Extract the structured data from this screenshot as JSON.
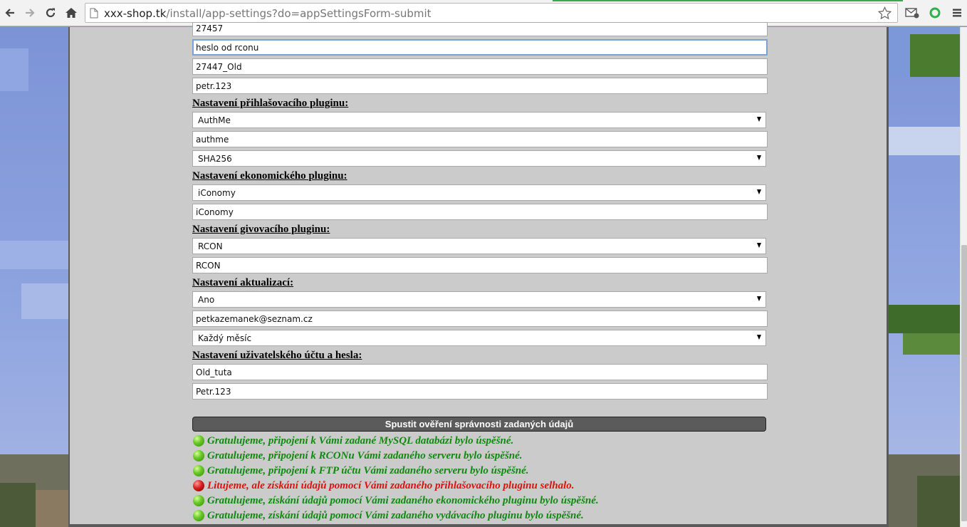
{
  "browser": {
    "url_host": "xxx-shop.tk",
    "url_path": "/install/app-settings?do=appSettingsForm-submit"
  },
  "form": {
    "rcon_port": "27457",
    "rcon_password": "heslo od rconu",
    "ftp_user": "27447_Old",
    "ftp_password": "petr.123",
    "login_heading": "Nastavení přihlašovacího pluginu:",
    "login_plugin": "AuthMe",
    "login_table": "authme",
    "login_hash": "SHA256",
    "economy_heading": "Nastavení ekonomického pluginu:",
    "economy_plugin": "iConomy",
    "economy_table": "iConomy",
    "give_heading": "Nastavení givovacího pluginu:",
    "give_plugin": "RCON",
    "give_value": "RCON",
    "update_heading": "Nastavení aktualizací:",
    "update_enabled": "Ano",
    "update_email": "petkazemanek@seznam.cz",
    "update_interval": "Každý měsíc",
    "account_heading": "Nastavení uživatelského účtu a hesla:",
    "account_user": "Old_tuta",
    "account_password": "Petr.123",
    "verify_button": "Spustit ověření správnosti zadaných údajů"
  },
  "messages": [
    {
      "status": "ok",
      "text": "Gratulujeme, připojení k Vámi zadané MySQL databázi bylo úspěšné."
    },
    {
      "status": "ok",
      "text": "Gratulujeme, připojení k RCONu Vámi zadaného serveru bylo úspěšné."
    },
    {
      "status": "ok",
      "text": "Gratulujeme, připojení k FTP účtu Vámi zadaného serveru bylo úspěšné."
    },
    {
      "status": "error",
      "text": "Litujeme, ale získání údajů pomocí Vámi zadaného přihlašovacího pluginu selhalo."
    },
    {
      "status": "ok",
      "text": "Gratulujeme, získání údajů pomocí Vámi zadaného ekonomického pluginu bylo úspěšné."
    },
    {
      "status": "ok",
      "text": "Gratulujeme, získání údajů pomocí Vámi zadaného vydávacího pluginu bylo úspěšné."
    }
  ],
  "colors": {
    "success": "#0f8a0f",
    "error": "#e01010",
    "panel": "#cbcbcb",
    "button": "#5b5b5b"
  },
  "icons": [
    "back-arrow-icon",
    "forward-arrow-icon",
    "reload-icon",
    "home-icon",
    "page-icon",
    "bookmark-star-icon",
    "mail-extension-icon",
    "green-circle-extension-icon",
    "menu-icon",
    "success-dot-icon",
    "error-dot-icon"
  ]
}
